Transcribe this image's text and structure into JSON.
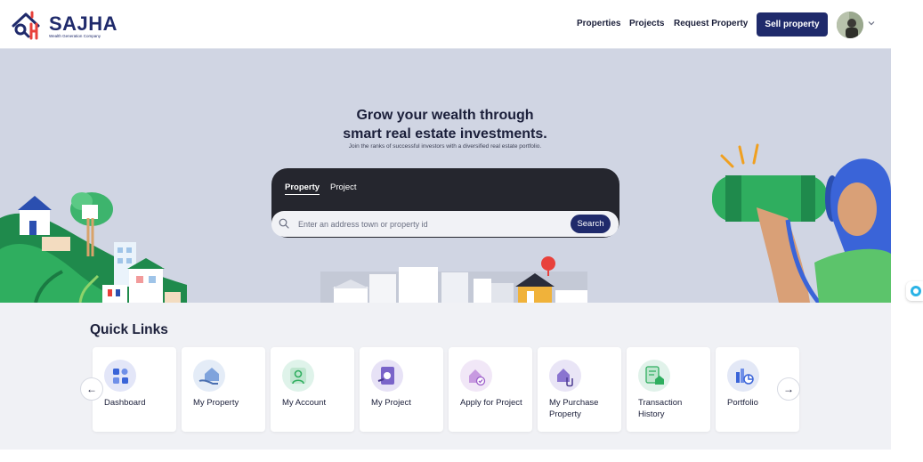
{
  "brand": {
    "name": "SAJHA",
    "tagline": "Wealth Generation Company",
    "colors": {
      "primary": "#1f2a6b",
      "accent": "#e8413b",
      "hero_bg": "#d0d5e3"
    }
  },
  "header": {
    "nav": [
      "Properties",
      "Projects",
      "Request Property"
    ],
    "sell_label": "Sell property",
    "avatar_icon": "user-avatar",
    "menu_icon": "chevron-down-icon"
  },
  "hero": {
    "title_line1": "Grow your wealth through",
    "title_line2": "smart real estate investments.",
    "subtitle": "Join the ranks of successful investors with a diversified real estate portfolio.",
    "tabs": [
      {
        "label": "Property",
        "active": true
      },
      {
        "label": "Project",
        "active": false
      }
    ],
    "search": {
      "placeholder": "Enter an address town or property id",
      "button": "Search",
      "icon": "search-icon"
    }
  },
  "quick_links": {
    "title": "Quick Links",
    "items": [
      {
        "label": "Dashboard",
        "icon": "dashboard-icon",
        "color": "#e3e6f8"
      },
      {
        "label": "My Property",
        "icon": "home-hand-icon",
        "color": "#e4ecf7"
      },
      {
        "label": "My Account",
        "icon": "user-icon",
        "color": "#dff3ea"
      },
      {
        "label": "My Project",
        "icon": "project-icon",
        "color": "#e7e2f6"
      },
      {
        "label": "Apply for Project",
        "icon": "apply-icon",
        "color": "#f1e7f7"
      },
      {
        "label": "My Purchase Property",
        "icon": "purchase-icon",
        "color": "#e9e5f6"
      },
      {
        "label": "Transaction History",
        "icon": "transaction-icon",
        "color": "#e1f2ea"
      },
      {
        "label": "Portfolio",
        "icon": "portfolio-icon",
        "color": "#e3e8f6"
      }
    ],
    "prev_icon": "arrow-left-icon",
    "next_icon": "arrow-right-icon"
  }
}
